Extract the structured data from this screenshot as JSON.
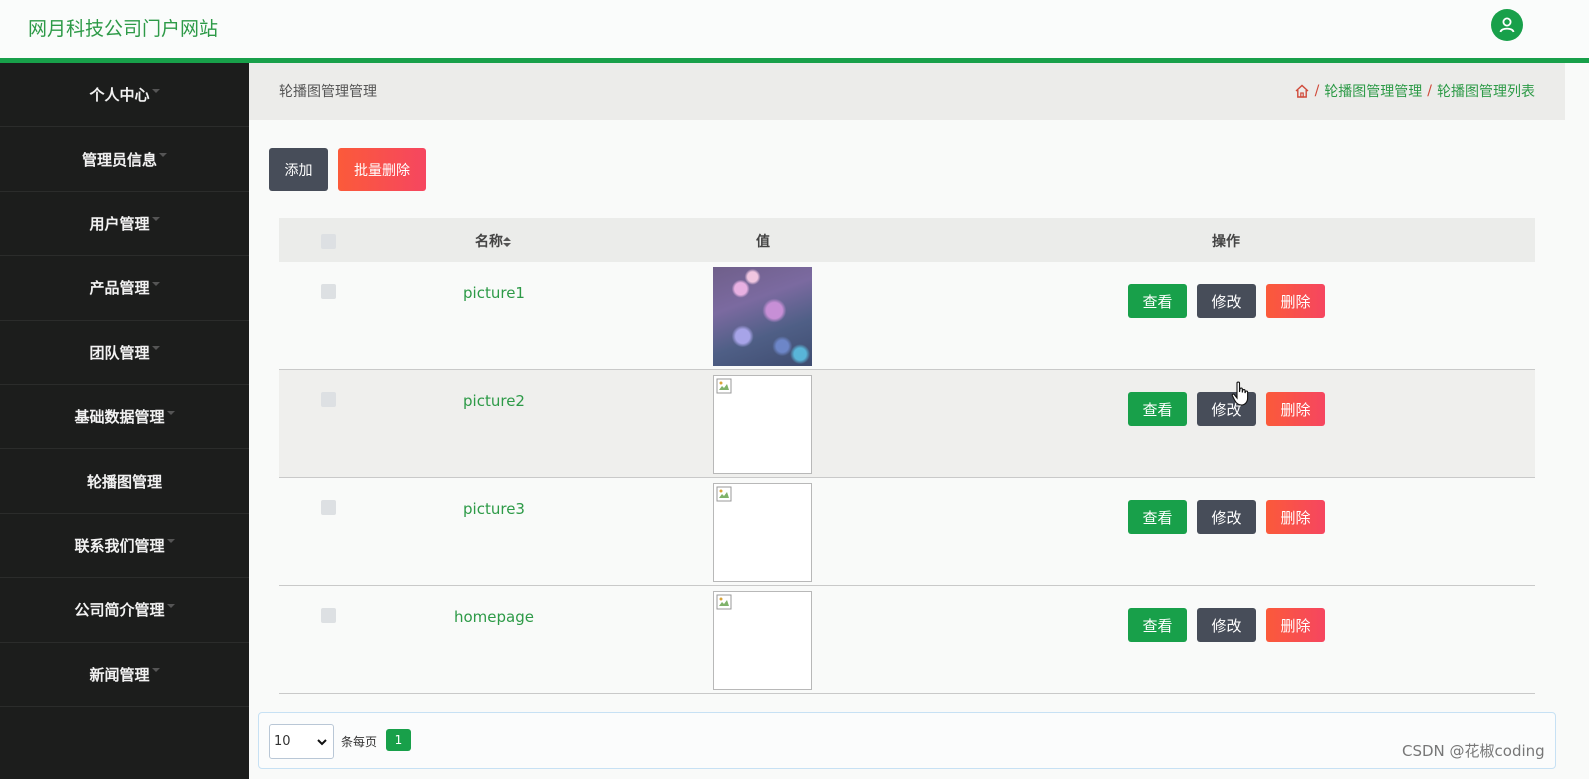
{
  "app": {
    "title": "网月科技公司门户网站",
    "user_icon": "user-avatar-icon"
  },
  "sidebar": {
    "items": [
      {
        "label": "个人中心",
        "has_caret": true
      },
      {
        "label": "管理员信息",
        "has_caret": true
      },
      {
        "label": "用户管理",
        "has_caret": true
      },
      {
        "label": "产品管理",
        "has_caret": true
      },
      {
        "label": "团队管理",
        "has_caret": true
      },
      {
        "label": "基础数据管理",
        "has_caret": true
      },
      {
        "label": "轮播图管理",
        "has_caret": false
      },
      {
        "label": "联系我们管理",
        "has_caret": true
      },
      {
        "label": "公司简介管理",
        "has_caret": true
      },
      {
        "label": "新闻管理",
        "has_caret": true
      }
    ]
  },
  "header": {
    "page_title": "轮播图管理管理",
    "breadcrumb": [
      "轮播图管理管理",
      "轮播图管理列表"
    ],
    "separator": "/"
  },
  "toolbar": {
    "add_label": "添加",
    "batch_delete_label": "批量删除"
  },
  "table": {
    "columns": {
      "name": "名称",
      "value": "值",
      "actions": "操作"
    },
    "rows": [
      {
        "name": "picture1",
        "image": "loaded"
      },
      {
        "name": "picture2",
        "image": "broken"
      },
      {
        "name": "picture3",
        "image": "broken"
      },
      {
        "name": "homepage",
        "image": "broken"
      }
    ],
    "actions": {
      "view": "查看",
      "edit": "修改",
      "delete": "删除"
    }
  },
  "pagination": {
    "page_size": "10",
    "per_page_label": "条每页",
    "current_page": "1"
  },
  "watermark": "CSDN @花椒coding",
  "colors": {
    "brand_green": "#18a04a",
    "dark_button": "#474d59",
    "danger": "#f64660",
    "sidebar_bg": "#1c1d1c"
  }
}
